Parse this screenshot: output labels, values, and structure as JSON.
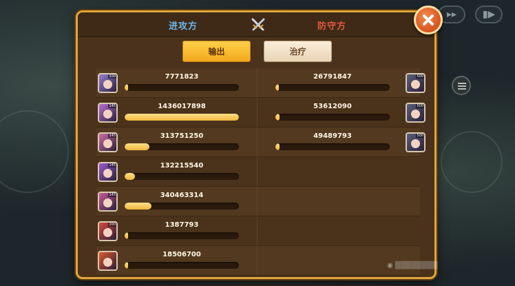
{
  "dialog": {
    "attacker_title": "进攻方",
    "defender_title": "防守方",
    "tabs": {
      "output": "输出",
      "heal": "治疗"
    },
    "active_tab": "output"
  },
  "attackers": [
    {
      "value": "7771823",
      "fill": 0.005,
      "color": "#9a7ed6",
      "level": "100"
    },
    {
      "value": "1436017898",
      "fill": 1.0,
      "color": "#b96fd3",
      "level": "145"
    },
    {
      "value": "313751250",
      "fill": 0.218,
      "color": "#d06ea8",
      "level": "145"
    },
    {
      "value": "132215540",
      "fill": 0.092,
      "color": "#9b5ad0",
      "level": "145"
    },
    {
      "value": "340463314",
      "fill": 0.237,
      "color": "#c85b98",
      "level": "145"
    },
    {
      "value": "1387793",
      "fill": 0.001,
      "color": "#d64a3a",
      "level": "200"
    },
    {
      "value": "18506700",
      "fill": 0.013,
      "color": "#e0582a",
      "level": ""
    }
  ],
  "defenders": [
    {
      "value": "26791847",
      "fill": 0.019,
      "color": "#5a5f7a",
      "level": "500"
    },
    {
      "value": "53612090",
      "fill": 0.037,
      "color": "#5a5f7a",
      "level": "500"
    },
    {
      "value": "49489793",
      "fill": 0.034,
      "color": "#5a5f7a",
      "level": "500"
    }
  ],
  "background": {
    "menu_icon": "list-icon",
    "close_icon": "close-x-icon"
  },
  "colors": {
    "accent": "#f2b83c",
    "attacker": "#6fb4e8",
    "defender": "#e2563e"
  }
}
